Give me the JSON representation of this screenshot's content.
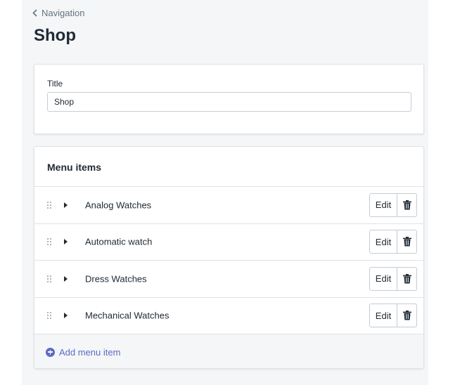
{
  "breadcrumb": {
    "label": "Navigation"
  },
  "page": {
    "title": "Shop"
  },
  "title_card": {
    "label": "Title",
    "value": "Shop"
  },
  "menu": {
    "heading": "Menu items",
    "items": [
      {
        "label": "Analog Watches"
      },
      {
        "label": "Automatic watch"
      },
      {
        "label": "Dress Watches"
      },
      {
        "label": "Mechanical Watches"
      }
    ],
    "edit_label": "Edit",
    "add_label": "Add menu item"
  },
  "colors": {
    "accent": "#5c6ac4",
    "background": "#f4f6f8",
    "text": "#212b36",
    "border": "#dfe3e8"
  }
}
